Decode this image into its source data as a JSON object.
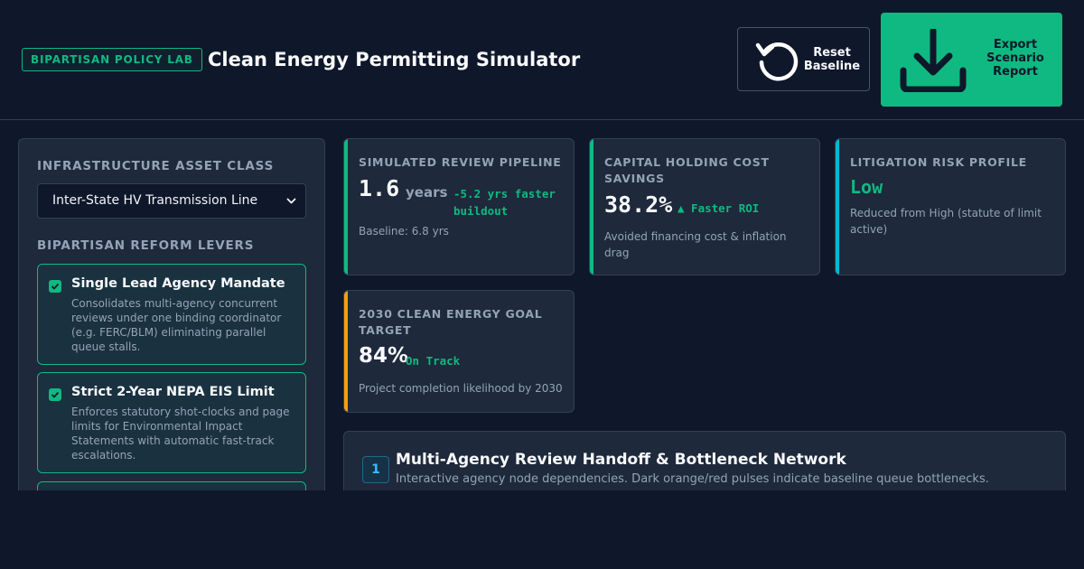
{
  "header": {
    "badge": "BIPARTISAN POLICY LAB",
    "title": "Clean Energy Permitting Simulator",
    "reset_label_1": "Reset",
    "reset_label_2": "Baseline",
    "export_label_1": "Export",
    "export_label_2": "Scenario",
    "export_label_3": "Report",
    "reset_icon": "refresh-icon",
    "export_icon": "download-icon"
  },
  "sidebar": {
    "asset_class_label": "INFRASTRUCTURE ASSET CLASS",
    "asset_class_selected": "Inter-State HV Transmission Line",
    "levers_label": "BIPARTISAN REFORM LEVERS",
    "levers": [
      {
        "title": "Single Lead Agency Mandate",
        "description_lines": [
          "Consolidates multi-agency concurrent",
          "reviews under one binding coordinator",
          "(e.g. FERC/BLM) eliminating parallel",
          "queue stalls."
        ],
        "checked": true
      },
      {
        "title": "Strict 2-Year NEPA EIS Limit",
        "description_lines": [
          "Enforces statutory shot-clocks and page",
          "limits for Environmental Impact",
          "Statements with automatic fast-track",
          "escalations."
        ],
        "checked": true
      }
    ]
  },
  "metrics": {
    "pipeline": {
      "title": "SIMULATED REVIEW PIPELINE",
      "value": "1.6",
      "unit": "years",
      "delta_1": "-5.2 yrs faster",
      "delta_2": "buildout",
      "note": "Baseline: 6.8 yrs"
    },
    "savings": {
      "title_1": "CAPITAL HOLDING COST",
      "title_2": "SAVINGS",
      "value": "38.2%",
      "delta": "▲ Faster ROI",
      "note_1": "Avoided financing cost & inflation",
      "note_2": "drag"
    },
    "litigation": {
      "title": "LITIGATION RISK PROFILE",
      "value": "Low",
      "note_1": "Reduced from High (statute of limit",
      "note_2": "active)"
    },
    "goal": {
      "title_1": "2030 CLEAN ENERGY GOAL",
      "title_2": "TARGET",
      "value": "84%",
      "delta": "On Track",
      "note": "Project completion likelihood by 2030"
    }
  },
  "network": {
    "step": "1",
    "title": "Multi-Agency Review Handoff & Bottleneck Network",
    "subtitle": "Interactive agency node dependencies. Dark orange/red pulses indicate baseline queue bottlenecks."
  },
  "colors": {
    "background": "#0f172a",
    "panel": "#1e293b",
    "accent_green": "#10b981",
    "accent_cyan": "#06b6d4",
    "accent_amber": "#f59e0b",
    "muted": "#94a3b8"
  }
}
